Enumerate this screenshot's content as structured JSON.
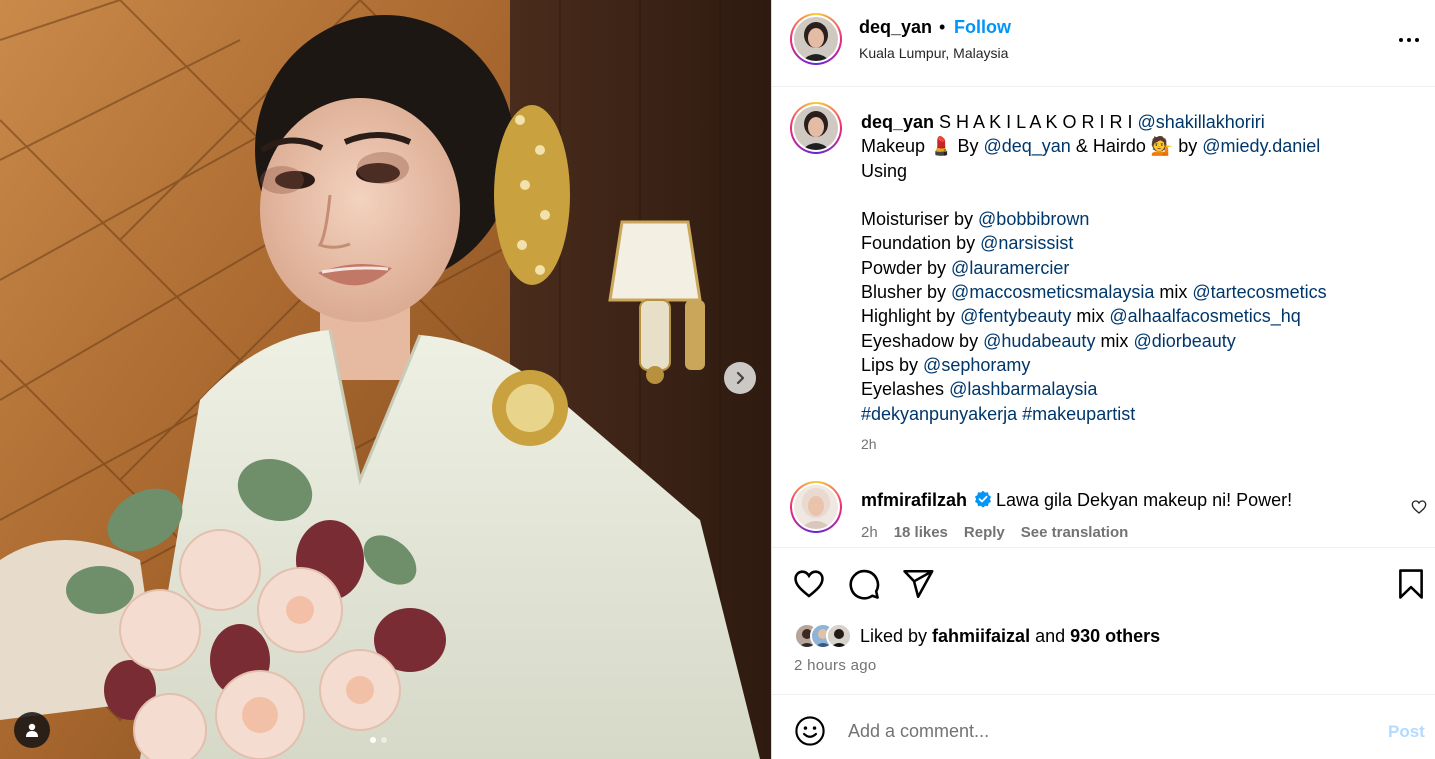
{
  "post": {
    "username": "deq_yan",
    "follow_label": "Follow",
    "separator": "•",
    "location": "Kuala Lumpur, Malaysia",
    "more_label": "More options"
  },
  "caption": {
    "username": "deq_yan",
    "lines": [
      [
        {
          "t": "text",
          "v": "S H A K I L A K O R I R I "
        },
        {
          "t": "link",
          "v": "@shakillakhoriri"
        }
      ],
      [
        {
          "t": "text",
          "v": "Makeup 💄 By "
        },
        {
          "t": "link",
          "v": "@deq_yan"
        },
        {
          "t": "text",
          "v": " & Hairdo 💁 by "
        },
        {
          "t": "link",
          "v": "@miedy.daniel"
        }
      ],
      [
        {
          "t": "text",
          "v": "Using"
        }
      ],
      [],
      [
        {
          "t": "text",
          "v": "Moisturiser by "
        },
        {
          "t": "link",
          "v": "@bobbibrown"
        }
      ],
      [
        {
          "t": "text",
          "v": "Foundation by "
        },
        {
          "t": "link",
          "v": "@narsissist"
        }
      ],
      [
        {
          "t": "text",
          "v": "Powder by "
        },
        {
          "t": "link",
          "v": "@lauramercier"
        }
      ],
      [
        {
          "t": "text",
          "v": "Blusher by "
        },
        {
          "t": "link",
          "v": "@maccosmeticsmalaysia"
        },
        {
          "t": "text",
          "v": " mix "
        },
        {
          "t": "link",
          "v": "@tartecosmetics"
        }
      ],
      [
        {
          "t": "text",
          "v": "Highlight by "
        },
        {
          "t": "link",
          "v": "@fentybeauty"
        },
        {
          "t": "text",
          "v": " mix "
        },
        {
          "t": "link",
          "v": "@alhaalfacosmetics_hq"
        }
      ],
      [
        {
          "t": "text",
          "v": "Eyeshadow by "
        },
        {
          "t": "link",
          "v": "@hudabeauty"
        },
        {
          "t": "text",
          "v": " mix "
        },
        {
          "t": "link",
          "v": "@diorbeauty"
        }
      ],
      [
        {
          "t": "text",
          "v": "Lips by "
        },
        {
          "t": "link",
          "v": "@sephoramy"
        }
      ],
      [
        {
          "t": "text",
          "v": "Eyelashes "
        },
        {
          "t": "link",
          "v": "@lashbarmalaysia"
        }
      ],
      [
        {
          "t": "link",
          "v": "#dekyanpunyakerja"
        },
        {
          "t": "text",
          "v": " "
        },
        {
          "t": "link",
          "v": "#makeupartist"
        }
      ]
    ],
    "time": "2h"
  },
  "comment": {
    "username": "mfmirafilzah",
    "text": "Lawa gila Dekyan makeup ni! Power!",
    "time": "2h",
    "likes": "18 likes",
    "reply": "Reply",
    "see_translation": "See translation"
  },
  "likes": {
    "prefix": "Liked by ",
    "user": "fahmiifaizal",
    "middle": " and ",
    "others": "930 others"
  },
  "time_ago": "2 hours ago",
  "comment_box": {
    "placeholder": "Add a comment...",
    "post_label": "Post"
  },
  "carousel": {
    "total": 2,
    "active": 1
  },
  "colors": {
    "link": "#00376b",
    "follow": "#0095f6",
    "muted": "#737373",
    "post_disabled": "#b3dbff",
    "verified": "#0095f6"
  },
  "icons": [
    "heart-icon",
    "comment-icon",
    "share-icon",
    "bookmark-icon",
    "emoji-icon",
    "chevron-right-icon",
    "user-tag-icon",
    "verified-icon",
    "more-icon"
  ]
}
